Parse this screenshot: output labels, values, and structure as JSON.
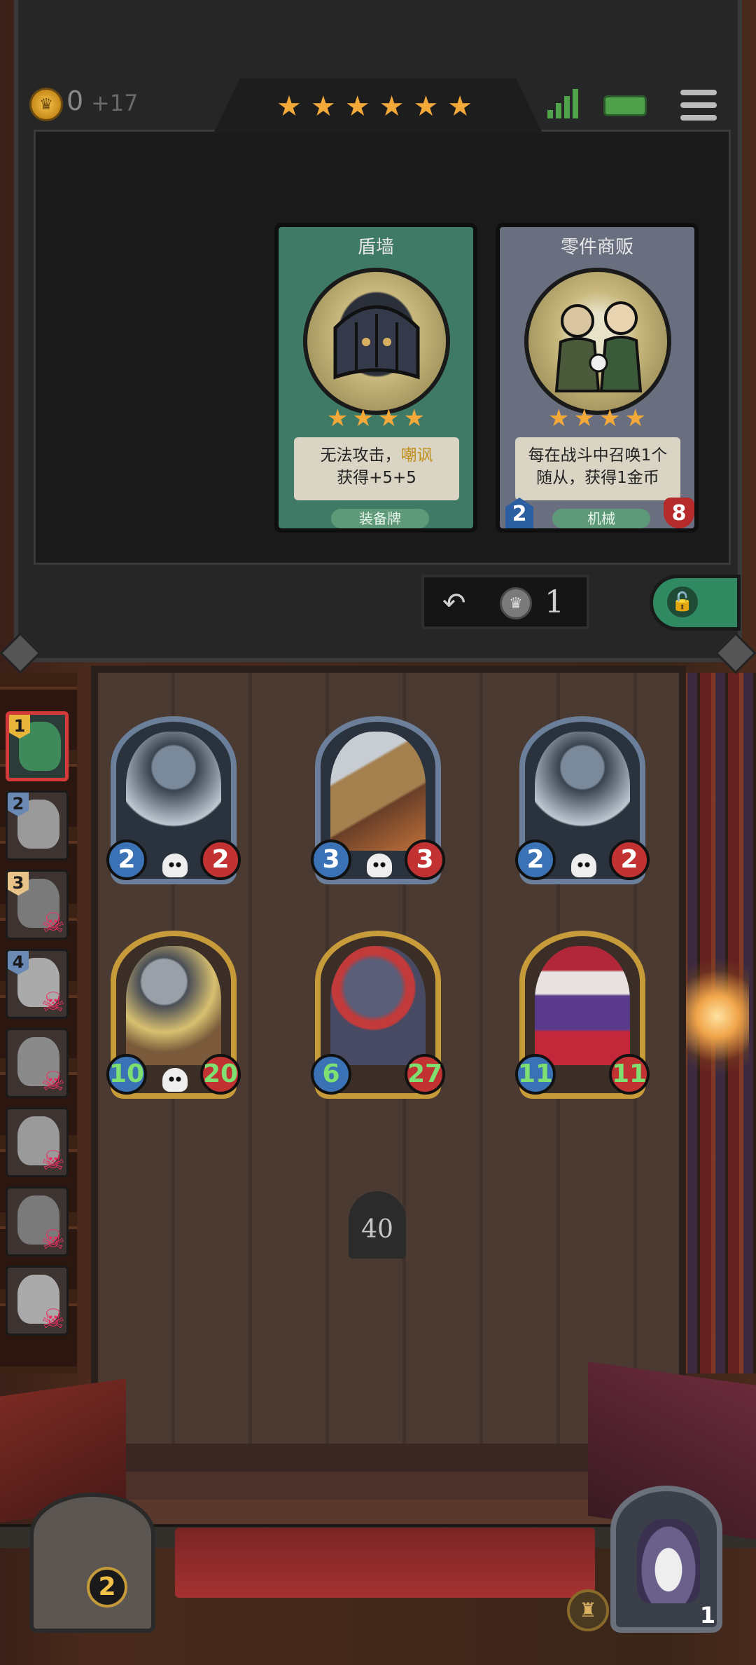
{
  "hud": {
    "gold": "0",
    "gold_income": "+17",
    "tier_stars": 6,
    "signal_bars": 4,
    "colors": {
      "star": "#f2a93a",
      "signal": "#4fa34a",
      "battery": "#4ea14a"
    }
  },
  "shop": {
    "cards": [
      {
        "title": "盾墙",
        "stars": 4,
        "desc_line1_a": "无法攻击，",
        "desc_line1_kw": "嘲讽",
        "desc_line2": "获得+5+5",
        "type": "装备牌",
        "frame_color": "#3f7a66",
        "art": "shield-wall-art"
      },
      {
        "title": "零件商贩",
        "stars": 4,
        "desc_line1": "每在战斗中召唤1个",
        "desc_line2": "随从，获得1金币",
        "type": "机械",
        "attack": "2",
        "health": "8",
        "frame_color": "#6a6f80",
        "art": "parts-merchant-art"
      }
    ],
    "refresh_cost": "1"
  },
  "roster": [
    {
      "rank": "1",
      "rank_color": "#e8b43a",
      "active": true,
      "dead": false
    },
    {
      "rank": "2",
      "rank_color": "#6a8ab5",
      "active": false,
      "dead": false
    },
    {
      "rank": "3",
      "rank_color": "#e8c48a",
      "active": false,
      "dead": true
    },
    {
      "rank": "4",
      "rank_color": "#6a8ab5",
      "active": false,
      "dead": true
    },
    {
      "rank": "",
      "active": false,
      "dead": true
    },
    {
      "rank": "",
      "active": false,
      "dead": true
    },
    {
      "rank": "",
      "active": false,
      "dead": true
    },
    {
      "rank": "",
      "active": false,
      "dead": true
    }
  ],
  "board": {
    "back_row": [
      {
        "name": "bell-robot",
        "attack": "2",
        "health": "2",
        "frame": "silver"
      },
      {
        "name": "missile-robot",
        "attack": "3",
        "health": "3",
        "frame": "silver"
      },
      {
        "name": "bell-robot",
        "attack": "2",
        "health": "2",
        "frame": "silver"
      }
    ],
    "front_row": [
      {
        "name": "armored-knight",
        "attack": "10",
        "health": "20",
        "frame": "gold"
      },
      {
        "name": "rat-bandit",
        "attack": "6",
        "health": "27",
        "frame": "gold"
      },
      {
        "name": "clown",
        "attack": "11",
        "health": "11",
        "frame": "gold"
      }
    ],
    "timer": "40"
  },
  "player": {
    "chest_count": "2",
    "hero_health": "1"
  }
}
